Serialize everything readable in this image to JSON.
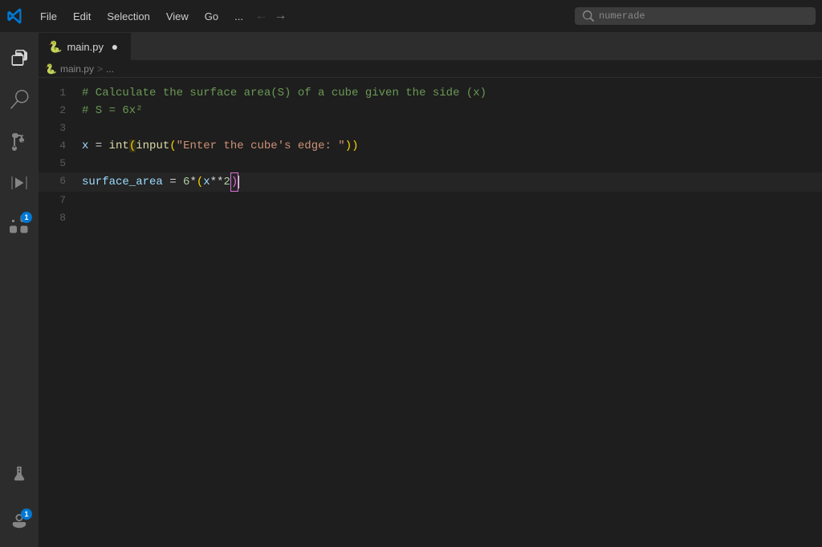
{
  "titlebar": {
    "logo_alt": "VS Code",
    "menu_items": [
      "File",
      "Edit",
      "Selection",
      "View",
      "Go",
      "..."
    ],
    "nav_back_label": "←",
    "nav_forward_label": "→",
    "search_placeholder": "numerade"
  },
  "activity_bar": {
    "icons": [
      {
        "name": "explorer-icon",
        "symbol": "📄",
        "active": true,
        "badge": null,
        "label": "Explorer"
      },
      {
        "name": "search-activity-icon",
        "symbol": "🔍",
        "active": false,
        "badge": null,
        "label": "Search"
      },
      {
        "name": "source-control-icon",
        "symbol": "⎇",
        "active": false,
        "badge": null,
        "label": "Source Control"
      },
      {
        "name": "run-icon",
        "symbol": "▶",
        "active": false,
        "badge": null,
        "label": "Run"
      },
      {
        "name": "extensions-icon",
        "symbol": "⊞",
        "active": false,
        "badge": "1",
        "label": "Extensions"
      }
    ],
    "bottom_icons": [
      {
        "name": "flask-icon",
        "symbol": "⚗",
        "label": "Testing"
      },
      {
        "name": "account-icon",
        "symbol": "👤",
        "badge": "1",
        "label": "Account"
      }
    ]
  },
  "tab": {
    "filename": "main.py",
    "unsaved": true,
    "icon_color": "#519aba"
  },
  "breadcrumb": {
    "file": "main.py",
    "separator": ">",
    "extra": "..."
  },
  "code": {
    "lines": [
      {
        "num": 1,
        "content": "# Calculate the surface area(S) of a cube given the side (x)",
        "type": "comment"
      },
      {
        "num": 2,
        "content": "# S = 6x²",
        "type": "comment"
      },
      {
        "num": 3,
        "content": "",
        "type": "empty"
      },
      {
        "num": 4,
        "content": "x = int(input(\"Enter the cube's edge: \"))",
        "type": "code"
      },
      {
        "num": 5,
        "content": "",
        "type": "empty"
      },
      {
        "num": 6,
        "content": "surface_area = 6*(x**2)",
        "type": "code",
        "cursor": true
      },
      {
        "num": 7,
        "content": "",
        "type": "empty"
      },
      {
        "num": 8,
        "content": "",
        "type": "empty"
      }
    ]
  }
}
